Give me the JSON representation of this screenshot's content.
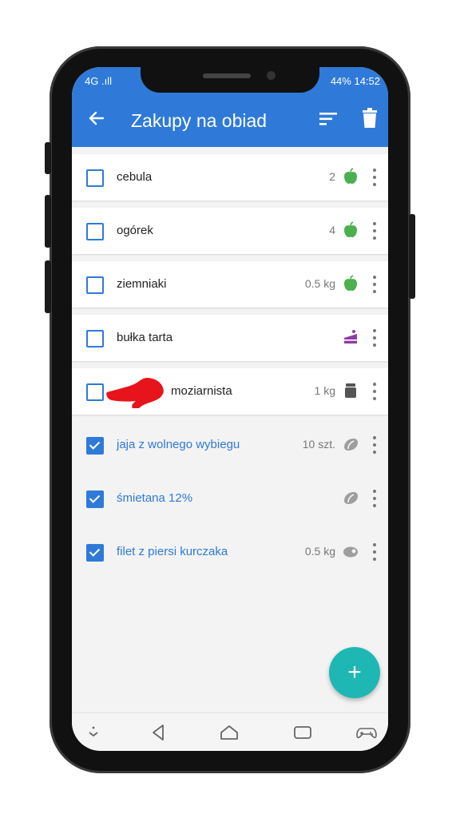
{
  "status": {
    "left": "4G .ıll",
    "right": "44% 14:52"
  },
  "appbar": {
    "title": "Zakupy na obiad"
  },
  "items": [
    {
      "name": "cebula",
      "qty": "2",
      "checked": false,
      "category_icon": "apple-icon"
    },
    {
      "name": "ogórek",
      "qty": "4",
      "checked": false,
      "category_icon": "apple-icon"
    },
    {
      "name": "ziemniaki",
      "qty": "0.5 kg",
      "checked": false,
      "category_icon": "apple-icon"
    },
    {
      "name": "bułka tarta",
      "qty": "",
      "checked": false,
      "category_icon": "cake-icon"
    },
    {
      "name": "moziarnista",
      "qty": "1 kg",
      "checked": false,
      "category_icon": "jar-icon"
    },
    {
      "name": "jaja z wolnego wybiegu",
      "qty": "10 szt.",
      "checked": true,
      "category_icon": "dairy-icon"
    },
    {
      "name": "śmietana 12%",
      "qty": "",
      "checked": true,
      "category_icon": "dairy-icon"
    },
    {
      "name": "filet z piersi kurczaka",
      "qty": "0.5 kg",
      "checked": true,
      "category_icon": "meat-icon"
    }
  ],
  "fab": {
    "label": "+"
  },
  "colors": {
    "primary": "#2f7ad8",
    "fab": "#1fb7b4",
    "apple": "#4caf50",
    "cake": "#8e3ba8",
    "jar": "#555555",
    "checked_text": "#2f7ad8"
  }
}
